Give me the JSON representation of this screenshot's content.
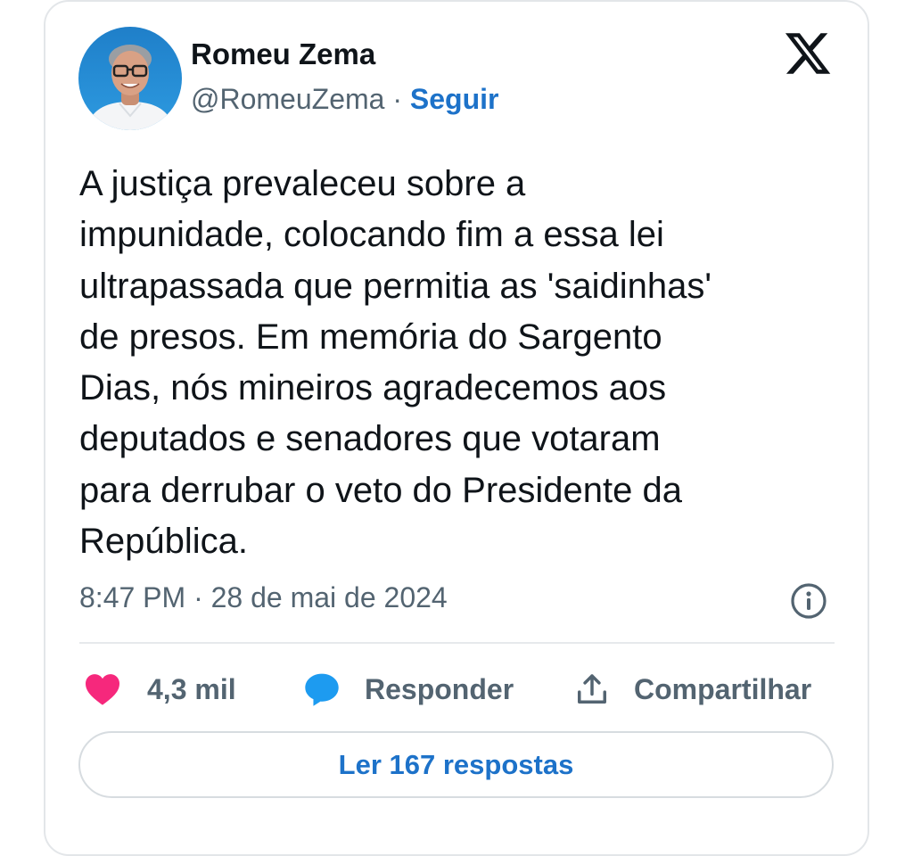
{
  "author": {
    "display_name": "Romeu Zema",
    "handle": "@RomeuZema",
    "separator": " · ",
    "follow_label": "Seguir"
  },
  "tweet": {
    "lines": [
      "A justiça prevaleceu sobre a",
      "impunidade, colocando fim a essa lei",
      "ultrapassada que permitia as 'saidinhas'",
      "de presos. Em memória do Sargento",
      "Dias, nós mineiros agradecemos aos",
      "deputados e senadores que votaram",
      "para derrubar o veto do Presidente da",
      "República."
    ],
    "timestamp": "8:47 PM · 28 de mai de 2024"
  },
  "actions": {
    "like_count": "4,3 mil",
    "reply_label": "Responder",
    "share_label": "Compartilhar"
  },
  "replies_button_label": "Ler 167 respostas",
  "icons": {
    "logo": "x-logo-icon",
    "info": "info-icon",
    "like": "heart-icon",
    "reply": "speech-bubble-icon",
    "share": "share-icon"
  },
  "colors": {
    "link_blue": "#1d72c9",
    "heart": "#f6287c",
    "reply_icon": "#1d9bf0",
    "muted_text": "#536471",
    "text": "#0f1419"
  }
}
